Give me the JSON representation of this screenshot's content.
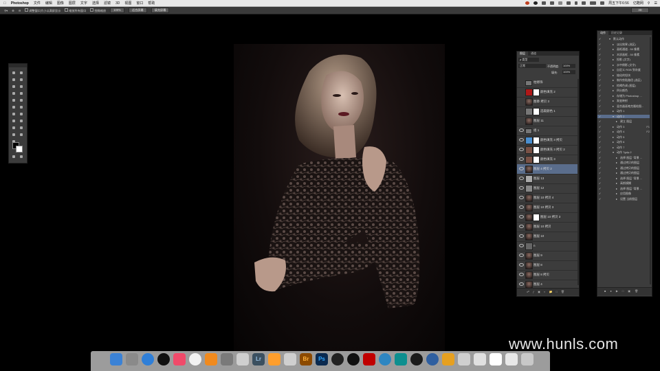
{
  "menubar": {
    "apple": "",
    "items": [
      "Photoshop",
      "文件",
      "编辑",
      "图像",
      "图层",
      "文字",
      "选择",
      "滤镜",
      "3D",
      "视图",
      "窗口",
      "帮助"
    ],
    "status": {
      "clock": "周五下午6:56",
      "user": "亿酷网"
    }
  },
  "optionsbar": {
    "resize_windows": "调整窗口大小以满屏显示",
    "zoom_all": "缩放所有窗口",
    "scrubby": "细微缩放",
    "zoom_value": "100%",
    "fit_screen": "适合屏幕",
    "fill_screen": "填充屏幕",
    "workspace": "3D"
  },
  "layers_panel": {
    "tabs": [
      "图层",
      "通道"
    ],
    "kind_filter": "ρ 类型",
    "blend_mode": "正常",
    "opacity_label": "不透明度:",
    "opacity_value": "100%",
    "fill_label": "填充:",
    "fill_value": "100%",
    "layers": [
      {
        "name": "柱修饰",
        "group": true,
        "visible": false
      },
      {
        "name": "颜色填充 2",
        "mask": true,
        "thumb": "#b01818",
        "visible": false
      },
      {
        "name": "图章 拷贝 3",
        "visible": false
      },
      {
        "name": "选取颜色 1",
        "mask": true,
        "thumb": "#777",
        "visible": false
      },
      {
        "name": "图层 11",
        "visible": false
      },
      {
        "name": "组 1",
        "group": true,
        "visible": true
      },
      {
        "name": "颜色填充 3 拷贝",
        "mask": true,
        "thumb": "#4a8fd0",
        "visible": true
      },
      {
        "name": "颜色填充 3 拷贝 2",
        "mask": true,
        "thumb": "#7a5246",
        "visible": true
      },
      {
        "name": "颜色填充 3",
        "mask": true,
        "thumb": "#7a5246",
        "visible": true
      },
      {
        "name": "图层 4 拷贝 2",
        "selected": true,
        "visible": true
      },
      {
        "name": "图层 13",
        "thumb": "#aaa",
        "visible": true
      },
      {
        "name": "图层 12",
        "thumb": "#888",
        "visible": true
      },
      {
        "name": "图层 10 拷贝 4",
        "visible": true
      },
      {
        "name": "图层 10 拷贝 3",
        "visible": true
      },
      {
        "name": "图层 10 拷贝 3",
        "mask": true,
        "visible": true
      },
      {
        "name": "图层 10 拷贝",
        "visible": true
      },
      {
        "name": "图层 10",
        "visible": true
      },
      {
        "name": "n",
        "thumb": "#666",
        "visible": true
      },
      {
        "name": "图层 9",
        "visible": true
      },
      {
        "name": "图层 8",
        "visible": true
      },
      {
        "name": "图层 8 拷贝",
        "visible": true
      },
      {
        "name": "图层 4",
        "visible": true
      }
    ]
  },
  "actions_panel": {
    "tabs": [
      "动作",
      "历史记录"
    ],
    "rows": [
      {
        "name": "默认动作",
        "indent": 1,
        "folder": true
      },
      {
        "name": "淡出效果 (选区)",
        "indent": 2
      },
      {
        "name": "画框通道 - 50 像素",
        "indent": 2
      },
      {
        "name": "木质画框 - 50 像素",
        "indent": 2
      },
      {
        "name": "投影 (文字)",
        "indent": 2
      },
      {
        "name": "水中倒影 (文字)",
        "indent": 2
      },
      {
        "name": "自定义 RGB 到灰度",
        "indent": 2
      },
      {
        "name": "熔化的铅块",
        "indent": 2
      },
      {
        "name": "制作剪贴路径 (选区)",
        "indent": 2
      },
      {
        "name": "棕褐色调 (图层)",
        "indent": 2
      },
      {
        "name": "四分颜色",
        "indent": 2
      },
      {
        "name": "存储为 Photoshop ...",
        "indent": 2
      },
      {
        "name": "渐变映射",
        "indent": 2
      },
      {
        "name": "混合器画笔克隆绘图...",
        "indent": 2
      },
      {
        "name": "动作 1",
        "indent": 2
      },
      {
        "name": "动作 2",
        "indent": 2,
        "selected": true,
        "open": true
      },
      {
        "name": "建立 图层",
        "indent": 3
      },
      {
        "name": "动作 3",
        "indent": 2,
        "shortcut": "F1"
      },
      {
        "name": "动作 4",
        "indent": 2,
        "shortcut": "F2"
      },
      {
        "name": "动作 5",
        "indent": 2
      },
      {
        "name": "动作 6",
        "indent": 2
      },
      {
        "name": "动作 7",
        "indent": 2
      },
      {
        "name": "动作 7gdp-2",
        "indent": 2,
        "open": true
      },
      {
        "name": "选择 图层 \"背景 ...",
        "indent": 3
      },
      {
        "name": "通过拷贝的图层",
        "indent": 3
      },
      {
        "name": "通过拷贝的图层",
        "indent": 3
      },
      {
        "name": "通过拷贝的图层",
        "indent": 3
      },
      {
        "name": "选择 图层 \"背景 ...",
        "indent": 3
      },
      {
        "name": "高斯模糊",
        "indent": 3
      },
      {
        "name": "选择 图层 \"背景 ...",
        "indent": 3
      },
      {
        "name": "应用图像",
        "indent": 3
      },
      {
        "name": "设置 当前图层",
        "indent": 3
      }
    ]
  },
  "dock_icons": [
    "finder-icon",
    "launchpad-icon",
    "safari-icon",
    "qq-icon",
    "itunes-icon",
    "chrome-icon",
    "ibooks-icon",
    "system-preferences-icon",
    "placeholder-icon",
    "lightroom-icon",
    "app-icon",
    "placeholder-icon",
    "bridge-icon",
    "photoshop-icon",
    "davinci-icon",
    "qq-icon",
    "acrobat-icon",
    "feiq-icon",
    "camera-icon",
    "terminal-icon",
    "quicktime-icon",
    "betterzip-icon",
    "placeholder-icon",
    "finder-window-icon",
    "preview-icon",
    "window-icon",
    "trash-icon"
  ],
  "dock_colors": [
    "#3b82d6",
    "#8a8a8a",
    "#2f7fd8",
    "#111",
    "#f04a6a",
    "#f2f2f2",
    "#f08a1e",
    "#7a7a7a",
    "#cfcfcf",
    "#3b5060",
    "#ff9e2c",
    "#cfcfcf",
    "#8c4a00",
    "#0a2a50",
    "#222",
    "#111",
    "#c00000",
    "#2e86c1",
    "#0d8f8f",
    "#1b1b1b",
    "#2f5fa0",
    "#e6a020",
    "#cfcfcf",
    "#e0e0e0",
    "#ffffff",
    "#e8e8e8",
    "#c8c8c8"
  ],
  "dock_labels": {
    "lightroom": "Lr",
    "bridge": "Br",
    "photoshop": "Ps"
  },
  "watermark": "www.hunls.com"
}
